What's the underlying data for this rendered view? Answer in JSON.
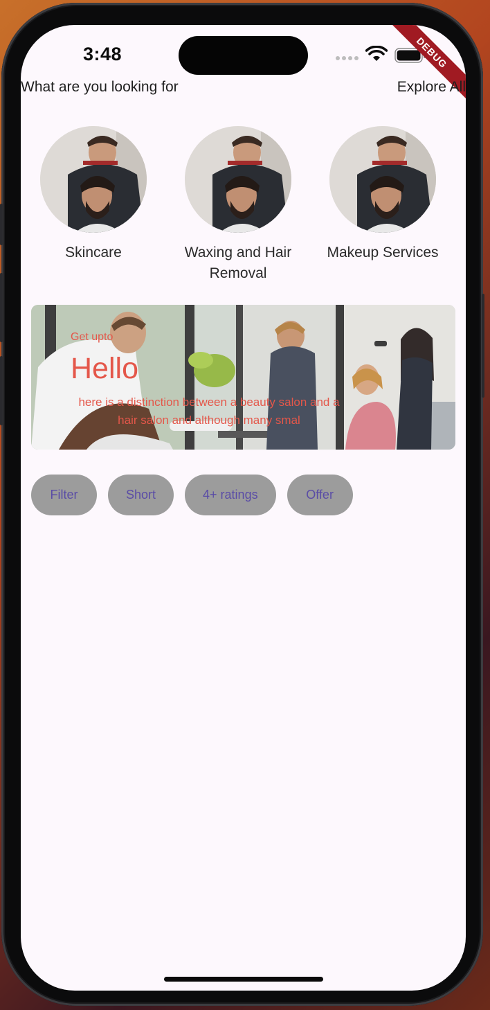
{
  "status_bar": {
    "time": "3:48",
    "debug_label": "DEBUG"
  },
  "header": {
    "title": "What are you looking for",
    "action": "Explore All"
  },
  "categories": [
    {
      "label": "Skincare",
      "icon": "barber-photo"
    },
    {
      "label": "Waxing and Hair Removal",
      "icon": "barber-photo"
    },
    {
      "label": "Makeup Services",
      "icon": "barber-photo"
    }
  ],
  "banner": {
    "small_text": "Get upto",
    "title": "Hello",
    "description": "here is a distinction between a beauty salon and a hair salon and although many smal",
    "text_color": "#e4574a"
  },
  "chips": [
    {
      "label": "Filter"
    },
    {
      "label": "Short"
    },
    {
      "label": "4+ ratings"
    },
    {
      "label": "Offer"
    }
  ],
  "colors": {
    "background": "#fdf8fd",
    "chip_bg": "#9c9c9c",
    "chip_text": "#5a4ca6",
    "accent": "#e4574a"
  }
}
